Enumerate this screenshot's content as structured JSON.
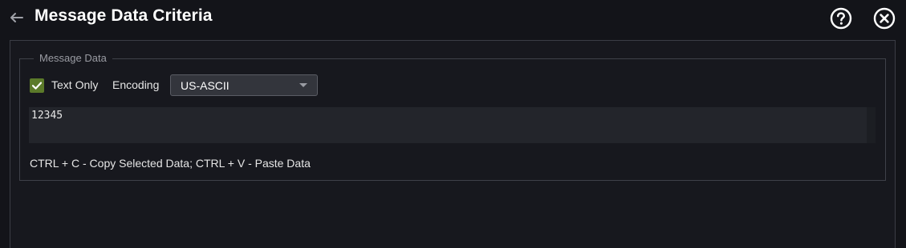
{
  "header": {
    "title": "Message Data Criteria",
    "back_icon": "arrow-left-icon",
    "help_icon": "question-circle-icon",
    "close_icon": "close-circle-icon"
  },
  "message_data": {
    "legend": "Message Data",
    "text_only": {
      "label": "Text Only",
      "checked": true
    },
    "encoding": {
      "label": "Encoding",
      "selected": "US-ASCII"
    },
    "data_value": "12345",
    "hint": "CTRL + C - Copy Selected Data; CTRL + V - Paste Data"
  },
  "colors": {
    "background": "#131419",
    "panel": "#17181e",
    "checkbox_accent": "#5b7a2a",
    "select_bg": "#33353c",
    "data_area_bg": "#23252b"
  }
}
